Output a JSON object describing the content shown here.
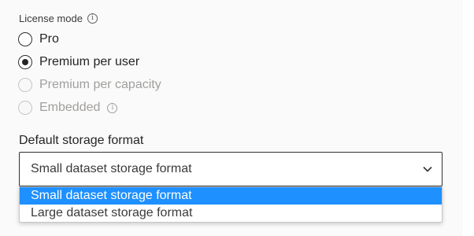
{
  "license": {
    "label": "License mode",
    "options": [
      {
        "label": "Pro",
        "checked": false,
        "disabled": false
      },
      {
        "label": "Premium per user",
        "checked": true,
        "disabled": false
      },
      {
        "label": "Premium per capacity",
        "checked": false,
        "disabled": true
      },
      {
        "label": "Embedded",
        "checked": false,
        "disabled": true
      }
    ]
  },
  "storage": {
    "label": "Default storage format",
    "selected": "Small dataset storage format",
    "options": [
      "Small dataset storage format",
      "Large dataset storage format"
    ]
  },
  "icons": {
    "info": "info-icon",
    "chevron": "chevron-down-icon"
  },
  "colors": {
    "highlight": "#1e90ff"
  }
}
